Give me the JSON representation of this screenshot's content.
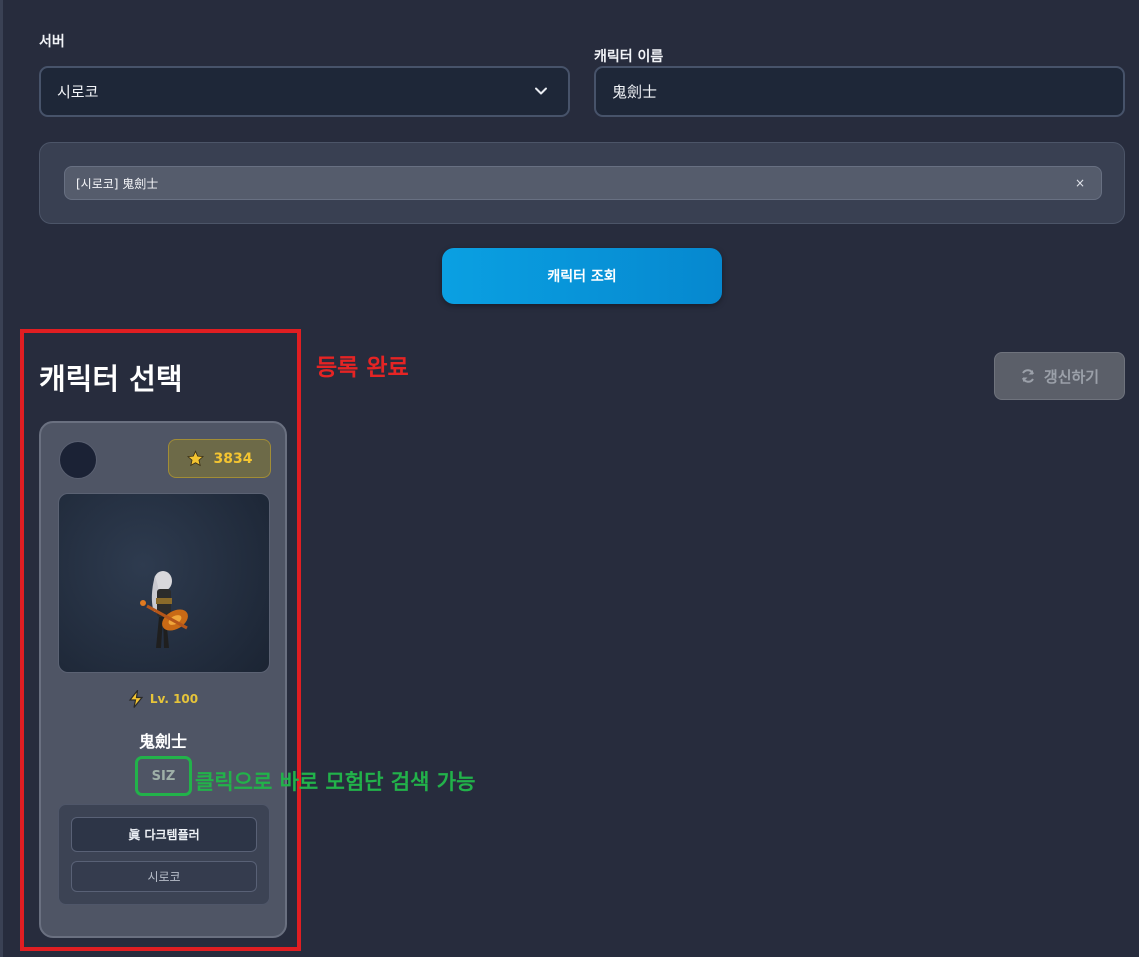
{
  "form": {
    "server_label": "서버",
    "server_value": "시로코",
    "name_label": "캐릭터 이름",
    "name_value": "鬼劍士"
  },
  "tags": [
    {
      "text": "[시로코] 鬼劍士",
      "close": "×"
    }
  ],
  "search_button": "캐릭터 조회",
  "section": {
    "title": "캐릭터 선택",
    "refresh_label": "갱신하기"
  },
  "annotations": {
    "registered": "등록 완료",
    "guild_hint": "클릭으로 바로 모험단 검색 가능"
  },
  "character": {
    "score": "3834",
    "level": "Lv. 100",
    "name": "鬼劍士",
    "guild": "SIZ",
    "job": "眞 다크템플러",
    "server": "시로코"
  },
  "colors": {
    "accent_blue": "#0aa0e2",
    "annotation_red": "#e01e22",
    "annotation_green": "#22b24a",
    "score_gold": "#f4c531"
  }
}
